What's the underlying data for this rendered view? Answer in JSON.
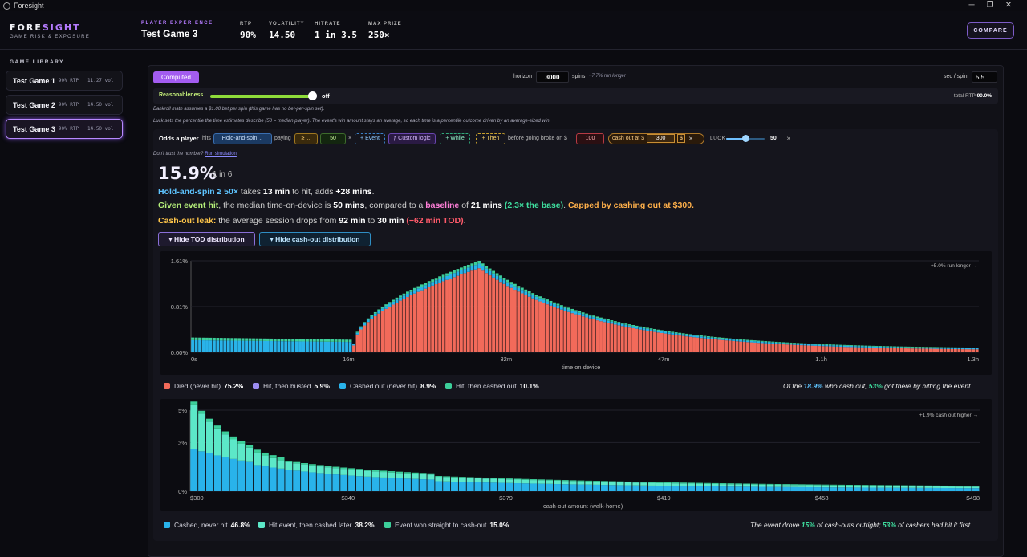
{
  "window": {
    "title": "Foresight",
    "controls": [
      "─",
      "❐",
      "✕"
    ]
  },
  "brand": {
    "name_a": "FORE",
    "name_b": "SIGHT",
    "subtitle": "GAME RISK & EXPOSURE"
  },
  "header": {
    "experience_label": "PLAYER EXPERIENCE",
    "game_name": "Test Game 3",
    "stats": [
      {
        "label": "RTP",
        "value": "90%"
      },
      {
        "label": "VOLATILITY",
        "value": "14.50"
      },
      {
        "label": "HITRATE",
        "value": "1 in 3.5"
      },
      {
        "label": "MAX PRIZE",
        "value": "250×"
      }
    ],
    "compare_label": "COMPARE"
  },
  "sidebar": {
    "title": "GAME LIBRARY",
    "games": [
      {
        "name": "Test Game 1",
        "meta": "90% RTP · 11.27 vol",
        "selected": false
      },
      {
        "name": "Test Game 2",
        "meta": "90% RTP · 14.50 vol",
        "selected": false
      },
      {
        "name": "Test Game 3",
        "meta": "90% RTP · 14.50 vol",
        "selected": true
      }
    ]
  },
  "controls": {
    "computed_label": "Computed",
    "horizon_label": "horizon",
    "horizon_value": "3000",
    "spins_label": "spins",
    "run_note": "~7.7% run longer",
    "sec_per_spin_label": "sec / spin",
    "sec_per_spin_value": "5.5",
    "reasonableness_label": "Reasonableness",
    "reasonableness_state": "off",
    "total_rtp_label": "total RTP",
    "total_rtp_value": "90.0%",
    "note1": "Bankroll math assumes a $1.00 bet per spin (this game has no bet-per-spin set).",
    "note2": "Luck sets the percentile the time estimates describe (50 = median player). The event's win amount stays an average, so each time is a percentile outcome driven by an average-sized win."
  },
  "odds": {
    "lead": "Odds a player",
    "hits": "hits",
    "event_select": "Hold-and-spin",
    "paying": "paying",
    "op_select": "≥",
    "threshold": "50",
    "times": "×",
    "add_event": "+ Event",
    "custom_logic": "ƒ Custom logic",
    "while": "+ While",
    "then": "+ Then",
    "broke_label": "before going broke on $",
    "broke_value": "100",
    "cashout_label": "cash out at $",
    "cashout_value": "300",
    "dollar": "$",
    "luck_label": "LUCK",
    "luck_value": "50",
    "luck_level": 0.5,
    "distrust": "Don't trust the number?",
    "run_sim": "Run simulation"
  },
  "result": {
    "pct": "15.9%",
    "one_in": "~1 in 6",
    "s1": {
      "event": "Hold-and-spin ≥ 50×",
      "t1": " takes ",
      "time": "13 min",
      "t2": " to hit, adds ",
      "adds": "+28 mins",
      "t3": "."
    },
    "s2": {
      "lead": "Given event hit",
      "t1": ", the median time-on-device is ",
      "median": "50 mins",
      "t2": ", compared to a ",
      "baseline": "baseline",
      "t3": " of ",
      "base": "21 mins",
      "mult": "(2.3× the base)",
      "t4": ". ",
      "capped": "Capped by cashing out at $300."
    },
    "s3": {
      "lead": "Cash-out leak:",
      "t1": " the average session drops from ",
      "from": "92 min",
      "t2": " to ",
      "to": "30 min",
      "delta": "(−62 min TOD)",
      "t3": "."
    },
    "hide_tod": "Hide TOD distribution",
    "hide_cashout": "Hide cash-out distribution"
  },
  "colors": {
    "died": "#f26a5a",
    "hit_busted": "#9b8cf0",
    "cashed_never": "#29b3ea",
    "hit_cashed": "#3ccf9a",
    "cashed_later": "#5ce8c8",
    "accent": "#a35cf0"
  },
  "chart_data": [
    {
      "type": "bar",
      "stacked": true,
      "xlabel": "time on device",
      "x_ticks": [
        "0s",
        "16m",
        "32m",
        "47m",
        "1.1h",
        "1.3h"
      ],
      "y_ticks": [
        "0.00%",
        "0.81%",
        "1.61%"
      ],
      "ylim": [
        0,
        1.61
      ],
      "corner_note": "+5.0% run longer →",
      "shape": {
        "bins": 220,
        "onset_bin": 45,
        "peak_bin": 80,
        "peak_total": 1.61,
        "floor": 0.26,
        "tail": 0.06
      },
      "series": [
        {
          "name": "Died (never hit)",
          "pct": "75.2%"
        },
        {
          "name": "Hit, then busted",
          "pct": "5.9%"
        },
        {
          "name": "Cashed out (never hit)",
          "pct": "8.9%"
        },
        {
          "name": "Hit, then cashed out",
          "pct": "10.1%"
        }
      ],
      "summary": {
        "a": "Of the ",
        "b": "18.9%",
        "c": " who cash out, ",
        "d": "53%",
        "e": " got there by hitting the event."
      }
    },
    {
      "type": "bar",
      "stacked": true,
      "xlabel": "cash-out amount (walk-home)",
      "x_ticks": [
        "$300",
        "$340",
        "$379",
        "$419",
        "$458",
        "$498"
      ],
      "y_ticks": [
        "0%",
        "3%",
        "5%"
      ],
      "ylim": [
        0,
        5
      ],
      "corner_note": "+1.9% cash out higher →",
      "series": [
        {
          "name": "Cashed, never hit",
          "pct": "46.8%"
        },
        {
          "name": "Hit event, then cashed later",
          "pct": "38.2%"
        },
        {
          "name": "Event won straight to cash-out",
          "pct": "15.0%"
        }
      ],
      "summary": {
        "a": "The event drove ",
        "b": "15%",
        "c": " of cash-outs outright; ",
        "d": "53%",
        "e": " of cashers had hit it first."
      }
    }
  ]
}
